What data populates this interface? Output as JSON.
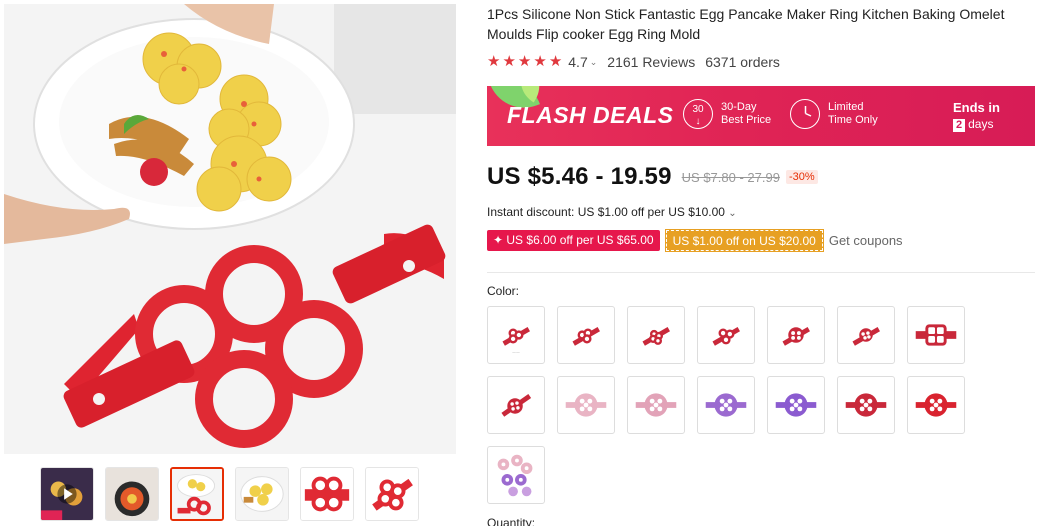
{
  "product": {
    "title": "1Pcs Silicone Non Stick Fantastic Egg Pancake Maker Ring Kitchen Baking Omelet Moulds Flip cooker Egg Ring Mold",
    "rating": "4.7",
    "reviews": "2161 Reviews",
    "orders": "6371 orders"
  },
  "flash_deals": {
    "title": "FLASH DEALS",
    "icon1_number": "30",
    "item1_line1": "30-Day",
    "item1_line2": "Best Price",
    "item2_line1": "Limited",
    "item2_line2": "Time Only",
    "ends_label": "Ends in",
    "ends_days_num": "2",
    "ends_days_unit": "days"
  },
  "price": {
    "current": "US $5.46 - 19.59",
    "original": "US $7.80 - 27.99",
    "discount": "-30%"
  },
  "instant_discount": "Instant discount: US $1.00 off per US $10.00",
  "coupons": {
    "red": "✦ US $6.00 off per US $65.00",
    "gold": "US $1.00 off on US $20.00",
    "link": "Get coupons"
  },
  "color_label": "Color:",
  "quantity_label": "Quantity:",
  "colors": {
    "brand_red": "#e02455",
    "price_red": "#e62e04",
    "coupon_gold": "#e7a023",
    "star": "#e0393e"
  },
  "icons": {
    "star": "star-icon",
    "chevron": "chevron-down-icon",
    "shield": "best-price-icon",
    "clock": "clock-icon"
  }
}
